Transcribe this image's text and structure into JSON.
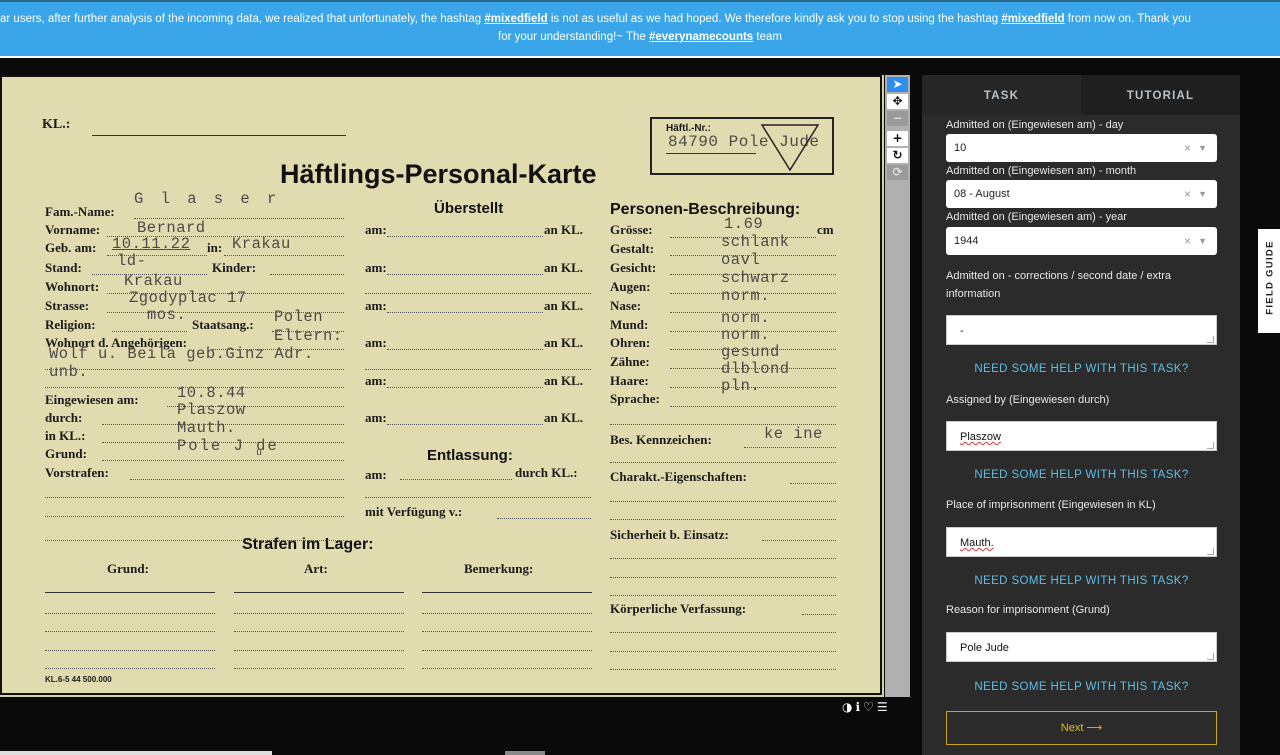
{
  "banner": {
    "line1_prefix": "ar users, after further analysis of the incoming data, we realized that unfortunately, the hashtag ",
    "hashtag": "#mixedfield",
    "line1_mid": " is not as useful as we had hoped. We therefore kindly ask you to stop using the hashtag ",
    "line1_suffix": " from now on. Thank you",
    "line2_prefix": "for your understanding!~ The ",
    "team_tag": "#everynamecounts",
    "line2_suffix": " team"
  },
  "card": {
    "kl": "KL.:",
    "haftl_label": "Häftl.-Nr.:",
    "haftl_value": "84790 Pole Jude",
    "title": "Häftlings-Personal-Karte",
    "left_labels": {
      "fam_name": "Fam.-Name:",
      "vorname": "Vorname:",
      "geb_am": "Geb. am:",
      "in": "in:",
      "stand": "Stand:",
      "kinder": "Kinder:",
      "wohnort": "Wohnort:",
      "strasse": "Strasse:",
      "religion": "Religion:",
      "staatsang": "Staatsang.:",
      "wohnort_ang": "Wohnort d. Angehörigen:",
      "eingewiesen_am": "Eingewiesen am:",
      "durch": "durch:",
      "in_kl": "in KL.:",
      "grund": "Grund:",
      "vorstrafen": "Vorstrafen:"
    },
    "left_values": {
      "fam_name": "G l a s e r",
      "vorname": "Bernard",
      "geb_am": "10.11.22",
      "geb_in": "Krakau",
      "stand": "ld-",
      "wohnort": "Krakau",
      "strasse": "Zgodyplac 17",
      "religion": "mos.",
      "staatsang": "Polen",
      "eltern": "Eltern:",
      "angehoerige": "Wolf u. Beila geb.Ginz Adr.",
      "unb": "unb.",
      "eingewiesen_am": "10.8.44",
      "durch": "Plaszow",
      "in_kl": "Mauth.",
      "grund": "Pole  J de",
      "grund_mark": "u"
    },
    "middle": {
      "ueberstellt": "Überstellt",
      "am": "am:",
      "an_kl": "an KL.",
      "entlassung": "Entlassung:",
      "durch_kl": "durch KL.:",
      "mit_verfuegung": "mit Verfügung v.:"
    },
    "right_labels": {
      "heading": "Personen-Beschreibung:",
      "groesse": "Grösse:",
      "cm": "cm",
      "gestalt": "Gestalt:",
      "gesicht": "Gesicht:",
      "augen": "Augen:",
      "nase": "Nase:",
      "mund": "Mund:",
      "ohren": "Ohren:",
      "zaehne": "Zähne:",
      "haare": "Haare:",
      "sprache": "Sprache:",
      "bes_kennzeichen": "Bes. Kennzeichen:",
      "charakt": "Charakt.-Eigenschaften:",
      "sicherheit": "Sicherheit b. Einsatz:",
      "koerperliche": "Körperliche Verfassung:"
    },
    "right_values": {
      "groesse": "1.69",
      "gestalt": "schlank",
      "gesicht": "oavl",
      "augen": "schwarz",
      "nase": "norm.",
      "mund": "norm.",
      "ohren": "norm.",
      "zaehne_1": "gesund",
      "zaehne_2": "dlblond",
      "sprache": "pln.",
      "bes_kennzeichen": "ke ine"
    },
    "strafen": {
      "heading": "Strafen im Lager:",
      "grund": "Grund:",
      "art": "Art:",
      "bemerkung": "Bemerkung:"
    },
    "footer": "KL.6-5 44 500.000"
  },
  "panel": {
    "tabs": [
      "TASK",
      "TUTORIAL"
    ],
    "fields": {
      "day_label": "Admitted on (Eingewiesen am) - day",
      "day_value": "10",
      "month_label": "Admitted on (Eingewiesen am) - month",
      "month_value": "08 - August",
      "year_label": "Admitted on (Eingewiesen am) - year",
      "year_value": "1944",
      "corrections_label": "Admitted on - corrections / second date / extra information",
      "corrections_value": "-",
      "assigned_label": "Assigned by (Eingewiesen durch)",
      "assigned_value": "Plaszow",
      "place_label": "Place of imprisonment (Eingewiesen in KL)",
      "place_value": "Mauth.",
      "reason_label": "Reason for imprisonment (Grund)",
      "reason_value": "Pole Jude"
    },
    "help": "NEED SOME HELP WITH THIS TASK?",
    "next": "Next ⟶",
    "field_guide": "FIELD GUIDE"
  },
  "viewer_icons": [
    "contrast-icon",
    "info-icon",
    "heart-icon",
    "list-icon"
  ]
}
